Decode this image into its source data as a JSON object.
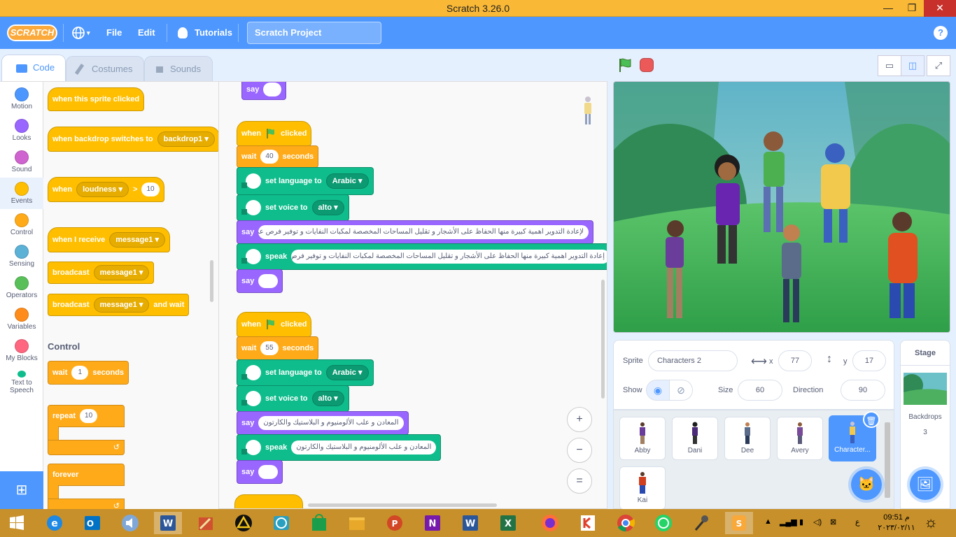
{
  "window": {
    "title": "Scratch 3.26.0",
    "minimize": "—",
    "restore": "❐",
    "close": "✕"
  },
  "menubar": {
    "logo": "SCRATCH",
    "file": "File",
    "edit": "Edit",
    "tutorials": "Tutorials",
    "project_title": "Scratch Project",
    "help": "?"
  },
  "tabs": {
    "code": "Code",
    "costumes": "Costumes",
    "sounds": "Sounds"
  },
  "categories": [
    {
      "label": "Motion",
      "color": "#4c97ff"
    },
    {
      "label": "Looks",
      "color": "#9966ff"
    },
    {
      "label": "Sound",
      "color": "#cf63cf"
    },
    {
      "label": "Events",
      "color": "#ffbf00"
    },
    {
      "label": "Control",
      "color": "#ffab19"
    },
    {
      "label": "Sensing",
      "color": "#5cb1d6"
    },
    {
      "label": "Operators",
      "color": "#59c059"
    },
    {
      "label": "Variables",
      "color": "#ff8c1a"
    },
    {
      "label": "My Blocks",
      "color": "#ff6680"
    }
  ],
  "tts_category": {
    "line1": "Text to",
    "line2": "Speech"
  },
  "palette": {
    "when_sprite_clicked": "when this sprite clicked",
    "when_backdrop": "when backdrop switches to",
    "backdrop_opt": "backdrop1",
    "when": "when",
    "loudness": "loudness",
    "gt": ">",
    "loud_val": "10",
    "when_receive": "when I receive",
    "message1": "message1",
    "broadcast": "broadcast",
    "and_wait": "and wait",
    "control_heading": "Control",
    "wait": "wait",
    "wait_val": "1",
    "seconds": "seconds",
    "repeat": "repeat",
    "repeat_val": "10",
    "forever": "forever"
  },
  "script": {
    "say": "say",
    "when": "when",
    "clicked": "clicked",
    "wait": "wait",
    "seconds": "seconds",
    "set_language": "set language to",
    "language": "Arabic",
    "set_voice": "set voice to",
    "voice": "alto",
    "speak": "speak",
    "stack1_wait": "40",
    "stack1_text": "لإعادة التدوير اهمية كبيرة   منها الحفاظ على الأشجار   و تقليل المساحات المخصصة لمكبات النفايات   و توفير فرص عمل جديدة",
    "stack1_speak": "إعادة التدوير اهمية كبيرة   منها الحفاظ على الأشجار   و تقليل المساحات المخصصة لمكبات النفايات   و توفير فرص عمل جديدة",
    "stack2_wait": "55",
    "stack2_text": "المعادن  و علب الألومنيوم  و البلاستيك   والكارتون"
  },
  "zoom": {
    "in": "+",
    "out": "−",
    "reset": "="
  },
  "stage_controls": {
    "small_stage": "▭",
    "normal_stage": "◫",
    "fullscreen": "⤢"
  },
  "sprite_info": {
    "sprite_label": "Sprite",
    "sprite_name": "Characters 2",
    "x_label": "x",
    "x_value": "77",
    "y_label": "y",
    "y_value": "17",
    "show_label": "Show",
    "size_label": "Size",
    "size_value": "60",
    "direction_label": "Direction",
    "direction_value": "90"
  },
  "sprites": [
    {
      "name": "Abby",
      "color": "#6a3d9a"
    },
    {
      "name": "Dani",
      "color": "#4b2a7a"
    },
    {
      "name": "Dee",
      "color": "#5a6c8a"
    },
    {
      "name": "Avery",
      "color": "#7a4a9a"
    },
    {
      "name": "Character...",
      "color": "#f2c94c"
    },
    {
      "name": "Kai",
      "color": "#d04020"
    }
  ],
  "stage_pane": {
    "title": "Stage",
    "backdrops_label": "Backdrops",
    "backdrops_count": "3"
  },
  "taskbar": {
    "lang": "ع",
    "time": "09:51 م",
    "date": "٢٠٢٣/٠٢/١١"
  }
}
